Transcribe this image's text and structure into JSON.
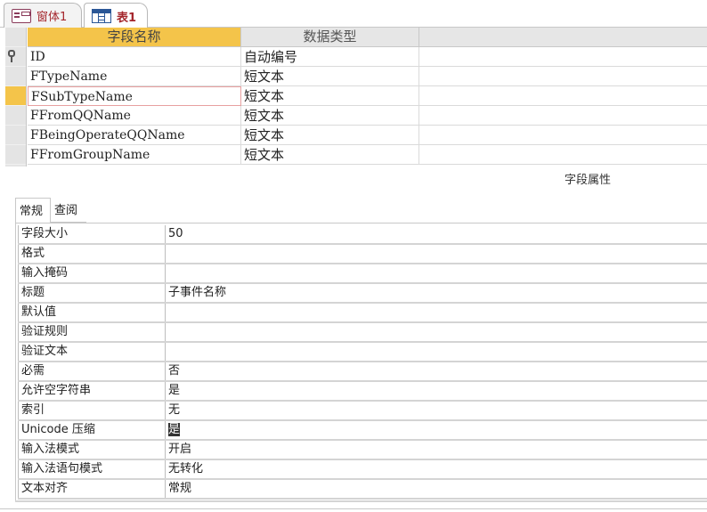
{
  "doc_tabs": [
    {
      "label": "窗体1",
      "icon": "form-icon"
    },
    {
      "label": "表1",
      "icon": "table-icon",
      "active": true
    }
  ],
  "design_grid": {
    "headers": {
      "field_name": "字段名称",
      "data_type": "数据类型",
      "description": ""
    },
    "rows": [
      {
        "name": "ID",
        "type": "自动编号",
        "primary_key": true
      },
      {
        "name": "FTypeName",
        "type": "短文本"
      },
      {
        "name": "FSubTypeName",
        "type": "短文本",
        "current": true
      },
      {
        "name": "FFromQQName",
        "type": "短文本"
      },
      {
        "name": "FBeingOperateQQName",
        "type": "短文本"
      },
      {
        "name": "FFromGroupName",
        "type": "短文本"
      }
    ]
  },
  "field_properties": {
    "title": "字段属性",
    "tabs": {
      "general": "常规",
      "lookup": "查阅"
    },
    "rows": [
      {
        "label": "字段大小",
        "value": "50"
      },
      {
        "label": "格式",
        "value": ""
      },
      {
        "label": "输入掩码",
        "value": ""
      },
      {
        "label": "标题",
        "value": "子事件名称"
      },
      {
        "label": "默认值",
        "value": ""
      },
      {
        "label": "验证规则",
        "value": ""
      },
      {
        "label": "验证文本",
        "value": ""
      },
      {
        "label": "必需",
        "value": "否"
      },
      {
        "label": "允许空字符串",
        "value": "是"
      },
      {
        "label": "索引",
        "value": "无"
      },
      {
        "label": "Unicode 压缩",
        "value": "是"
      },
      {
        "label": "输入法模式",
        "value": "开启"
      },
      {
        "label": "输入法语句模式",
        "value": "无转化"
      },
      {
        "label": "文本对齐",
        "value": "常规"
      }
    ]
  },
  "colors": {
    "accent": "#a4262c",
    "selection": "#f4c44a",
    "table_icon": "#2b5797",
    "form_icon": "#8a3a5a"
  }
}
